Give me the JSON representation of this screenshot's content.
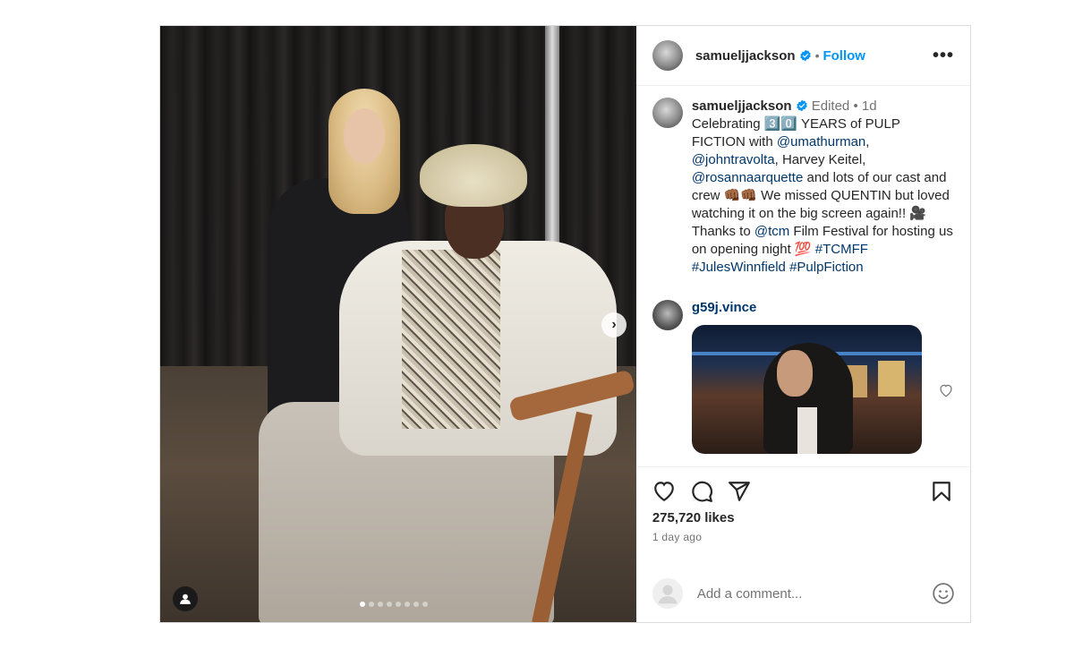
{
  "post": {
    "author": "samueljjackson",
    "follow_label": "Follow",
    "separator": "•",
    "more_label": "•••",
    "photo": {
      "carousel_dots": 8,
      "active_dot": 0,
      "next_label": "›"
    }
  },
  "caption": {
    "username": "samueljjackson",
    "edited_label": "Edited",
    "separator": "•",
    "age": "1d",
    "parts": [
      {
        "text": "Celebrating ",
        "kind": "text"
      },
      {
        "text": "3️⃣0️⃣",
        "kind": "text"
      },
      {
        "text": " YEARS of PULP FICTION with ",
        "kind": "text"
      },
      {
        "text": "@umathurman",
        "kind": "mention"
      },
      {
        "text": ", ",
        "kind": "text"
      },
      {
        "text": "@johntravolta",
        "kind": "mention"
      },
      {
        "text": ", Harvey Keitel, ",
        "kind": "text"
      },
      {
        "text": "@rosannaarquette",
        "kind": "mention"
      },
      {
        "text": " and lots of our cast and crew 👊🏾👊🏾 We missed QUENTIN but loved watching it on the big screen again!! 🎥 Thanks to ",
        "kind": "text"
      },
      {
        "text": "@tcm",
        "kind": "mention"
      },
      {
        "text": " Film Festival for hosting us on opening night 💯 ",
        "kind": "text"
      },
      {
        "text": "#TCMFF",
        "kind": "mention"
      },
      {
        "text": " ",
        "kind": "text"
      },
      {
        "text": "#JulesWinnfield",
        "kind": "mention"
      },
      {
        "text": " ",
        "kind": "text"
      },
      {
        "text": "#PulpFiction",
        "kind": "mention"
      }
    ]
  },
  "reply": {
    "username": "g59j.vince"
  },
  "stats": {
    "likes": "275,720 likes",
    "time_ago": "1 day ago"
  },
  "comment_box": {
    "placeholder": "Add a comment..."
  },
  "icons": {
    "verified": "verified-badge-icon",
    "like": "heart-icon",
    "comment": "comment-bubble-icon",
    "share": "paper-plane-icon",
    "save": "bookmark-icon",
    "emoji": "smiley-icon",
    "user_tag": "person-icon"
  },
  "colors": {
    "link": "#0095f6",
    "mention": "#00376b",
    "verified": "#0095f6",
    "muted": "#737373",
    "text": "#262626"
  }
}
